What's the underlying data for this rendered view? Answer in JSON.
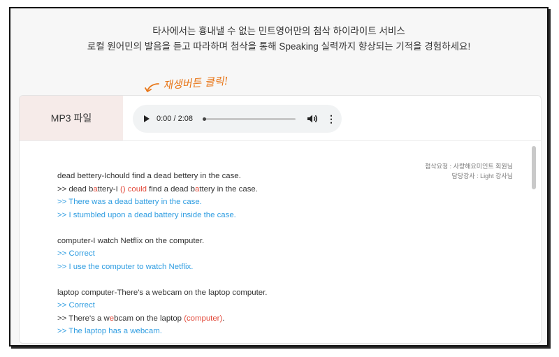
{
  "promo": {
    "line1": "타사에서는 흉내낼 수 없는 민트영어만의 첨삭 하이라이트 서비스",
    "line2": "로컬 원어민의 발음을 듣고 따라하며 첨삭을 통해 Speaking 실력까지 향상되는 기적을 경험하세요!"
  },
  "hint": "재생버튼 클릭!",
  "player": {
    "label": "MP3 파일",
    "time": "0:00 / 2:08",
    "progress": 0
  },
  "meta": {
    "requester": "첨삭요청 : 사랑해요미인트 회원님",
    "teacher": "담당강사 : Light 강사님"
  },
  "corrections": {
    "b1": {
      "orig": "dead bettery-Ichould find a dead bettery in the case.",
      "fix_pre": ">> dead b",
      "fix_a": "a",
      "fix_mid1": "ttery-I ",
      "fix_paren": "()",
      "fix_sp": " ",
      "fix_could": "could",
      "fix_mid2": " find a dead b",
      "fix_a2": "a",
      "fix_end": "ttery in the case.",
      "alt1": ">> There was a dead battery in the case.",
      "alt2": ">> I stumbled upon a dead battery inside the case."
    },
    "b2": {
      "orig": "computer-I watch Netflix on the computer.",
      "alt1": ">> Correct",
      "alt2": ">> I use the computer to watch Netflix."
    },
    "b3": {
      "orig": "laptop computer-There's a webcam on the laptop computer.",
      "alt1": ">> Correct",
      "fix_pre": ">> There's a w",
      "fix_e": "e",
      "fix_mid": "bcam on the laptop ",
      "fix_comp": "(computer)",
      "fix_end": ".",
      "alt_cut": ">> The laptop has a webcam."
    }
  }
}
